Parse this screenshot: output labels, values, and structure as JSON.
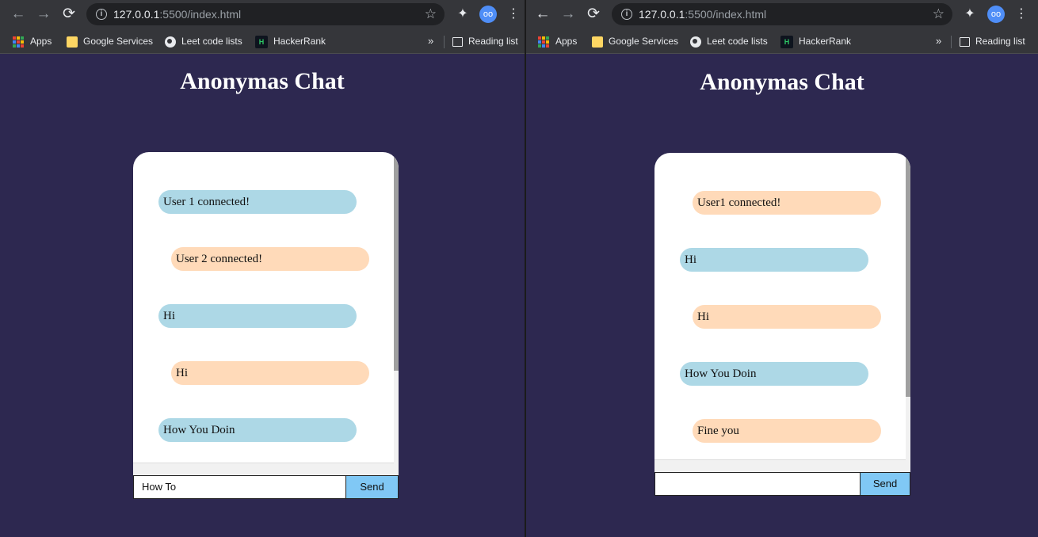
{
  "browser": {
    "url_host": "127.0.0.1",
    "url_path": ":5500/index.html",
    "bookmarks": {
      "apps": "Apps",
      "google_services": "Google Services",
      "leet_code": "Leet code lists",
      "hackerrank": "HackerRank",
      "overflow": "»",
      "reading_list": "Reading list"
    },
    "icons": {
      "back": "←",
      "forward": "→",
      "reload": "⟳",
      "info": "i",
      "star": "☆",
      "extensions": "✦",
      "menu": "⋮",
      "profile": "oo",
      "hackerrank_logo": "H"
    }
  },
  "page": {
    "title": "Anonymas Chat",
    "send_label": "Send"
  },
  "left": {
    "messages": [
      {
        "text": "User 1 connected!",
        "side": "sent",
        "color": "#add8e6"
      },
      {
        "text": "User 2 connected!",
        "side": "received",
        "color": "#ffdab9"
      },
      {
        "text": "Hi",
        "side": "sent",
        "color": "#add8e6"
      },
      {
        "text": "Hi",
        "side": "received",
        "color": "#ffdab9"
      },
      {
        "text": "How You Doin",
        "side": "sent",
        "color": "#add8e6"
      }
    ],
    "input_value": "How To"
  },
  "right": {
    "messages": [
      {
        "text": "User1 connected!",
        "side": "received",
        "color": "#ffdab9"
      },
      {
        "text": "Hi",
        "side": "sent",
        "color": "#add8e6"
      },
      {
        "text": "Hi",
        "side": "received",
        "color": "#ffdab9"
      },
      {
        "text": "How You Doin",
        "side": "sent",
        "color": "#add8e6"
      },
      {
        "text": "Fine you",
        "side": "received",
        "color": "#ffdab9"
      }
    ],
    "input_value": ""
  },
  "colors": {
    "page_bg": "#2d2850",
    "sent_bubble": "#add8e6",
    "received_bubble": "#ffdab9",
    "send_button": "#80c8f5"
  }
}
